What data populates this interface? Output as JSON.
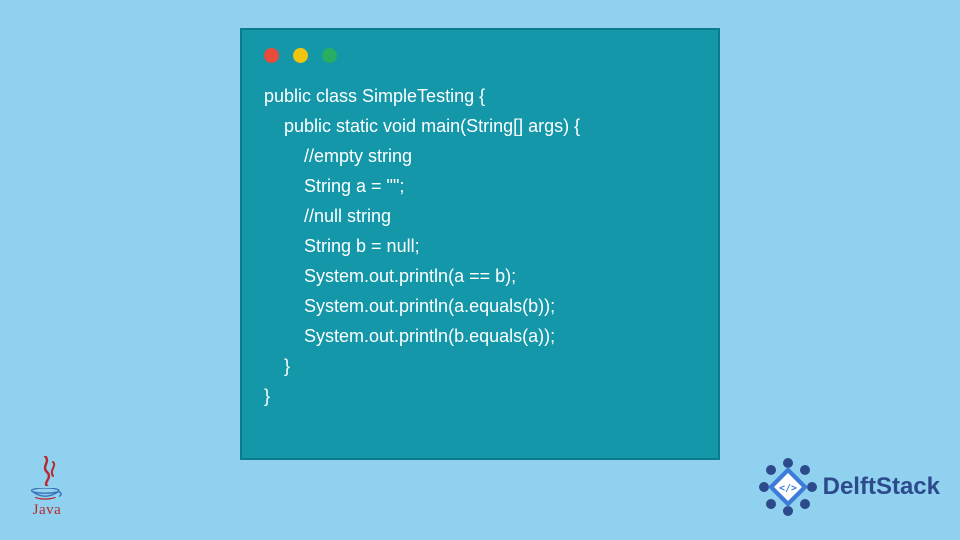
{
  "window": {
    "dots": {
      "red": "#e74c3c",
      "yellow": "#f1c40f",
      "green": "#27ae60"
    }
  },
  "code": {
    "text": "public class SimpleTesting {\n    public static void main(String[] args) {\n        //empty string\n        String a = \"\";\n        //null string\n        String b = null;\n        System.out.println(a == b);\n        System.out.println(a.equals(b));\n        System.out.println(b.equals(a));\n    }\n}"
  },
  "java_logo": {
    "label": "Java"
  },
  "delft_logo": {
    "brand": "DelftStack",
    "embed_glyph": "</>"
  }
}
